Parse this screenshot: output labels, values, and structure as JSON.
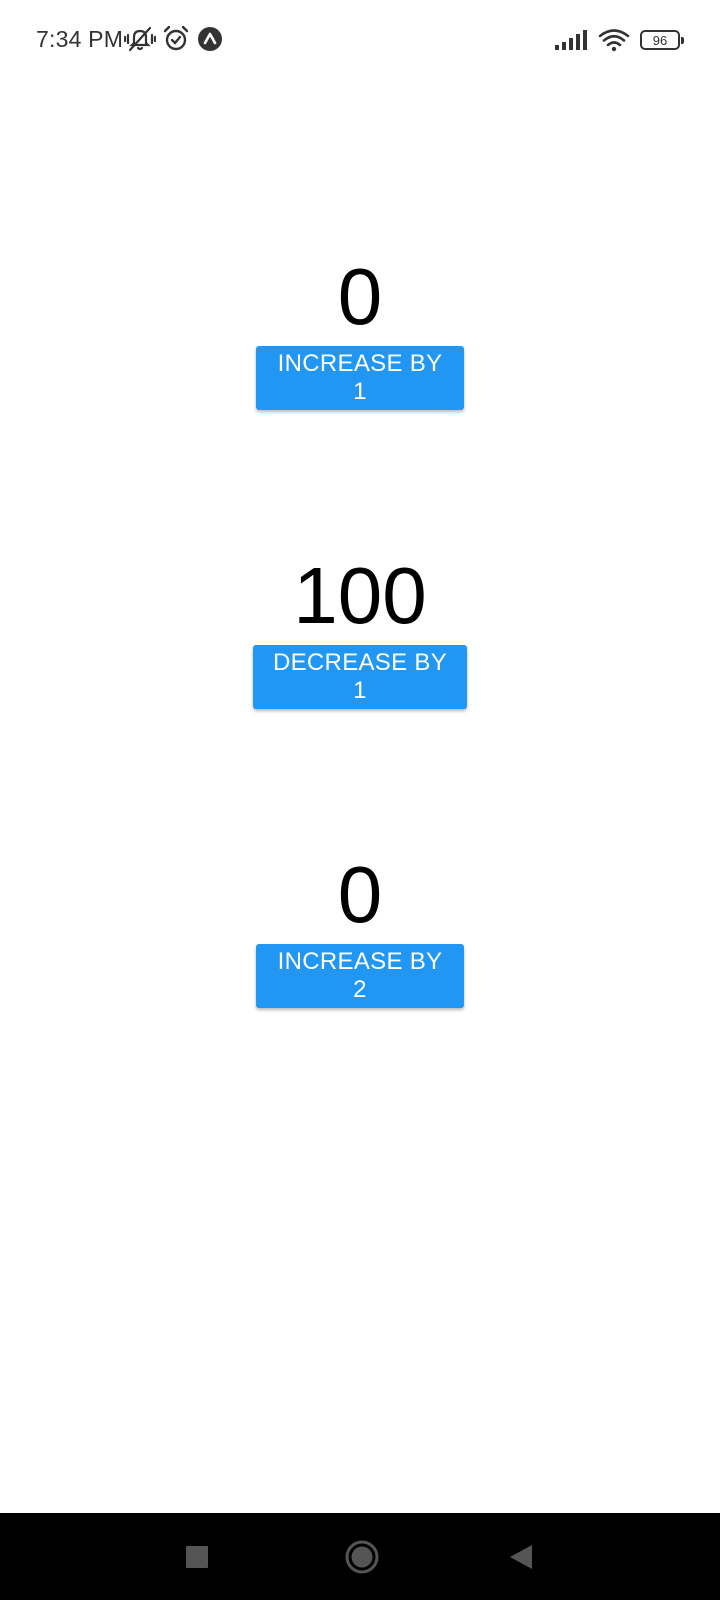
{
  "status_bar": {
    "time": "7:34 PM",
    "battery_level": "96",
    "icons_left": [
      "vibrate-off-icon",
      "alarm-icon",
      "app-notification-icon"
    ],
    "icons_right": [
      "signal-icon",
      "wifi-icon",
      "battery-icon"
    ]
  },
  "counters": [
    {
      "value": "0",
      "button_label": "INCREASE BY 1"
    },
    {
      "value": "100",
      "button_label": "DECREASE BY 1"
    },
    {
      "value": "0",
      "button_label": "INCREASE BY 2"
    }
  ],
  "colors": {
    "button_background": "#2196f3",
    "button_text": "#ffffff",
    "nav_bar": "#000000"
  },
  "nav_bar": {
    "icons": [
      "recents-icon",
      "home-icon",
      "back-icon"
    ]
  }
}
